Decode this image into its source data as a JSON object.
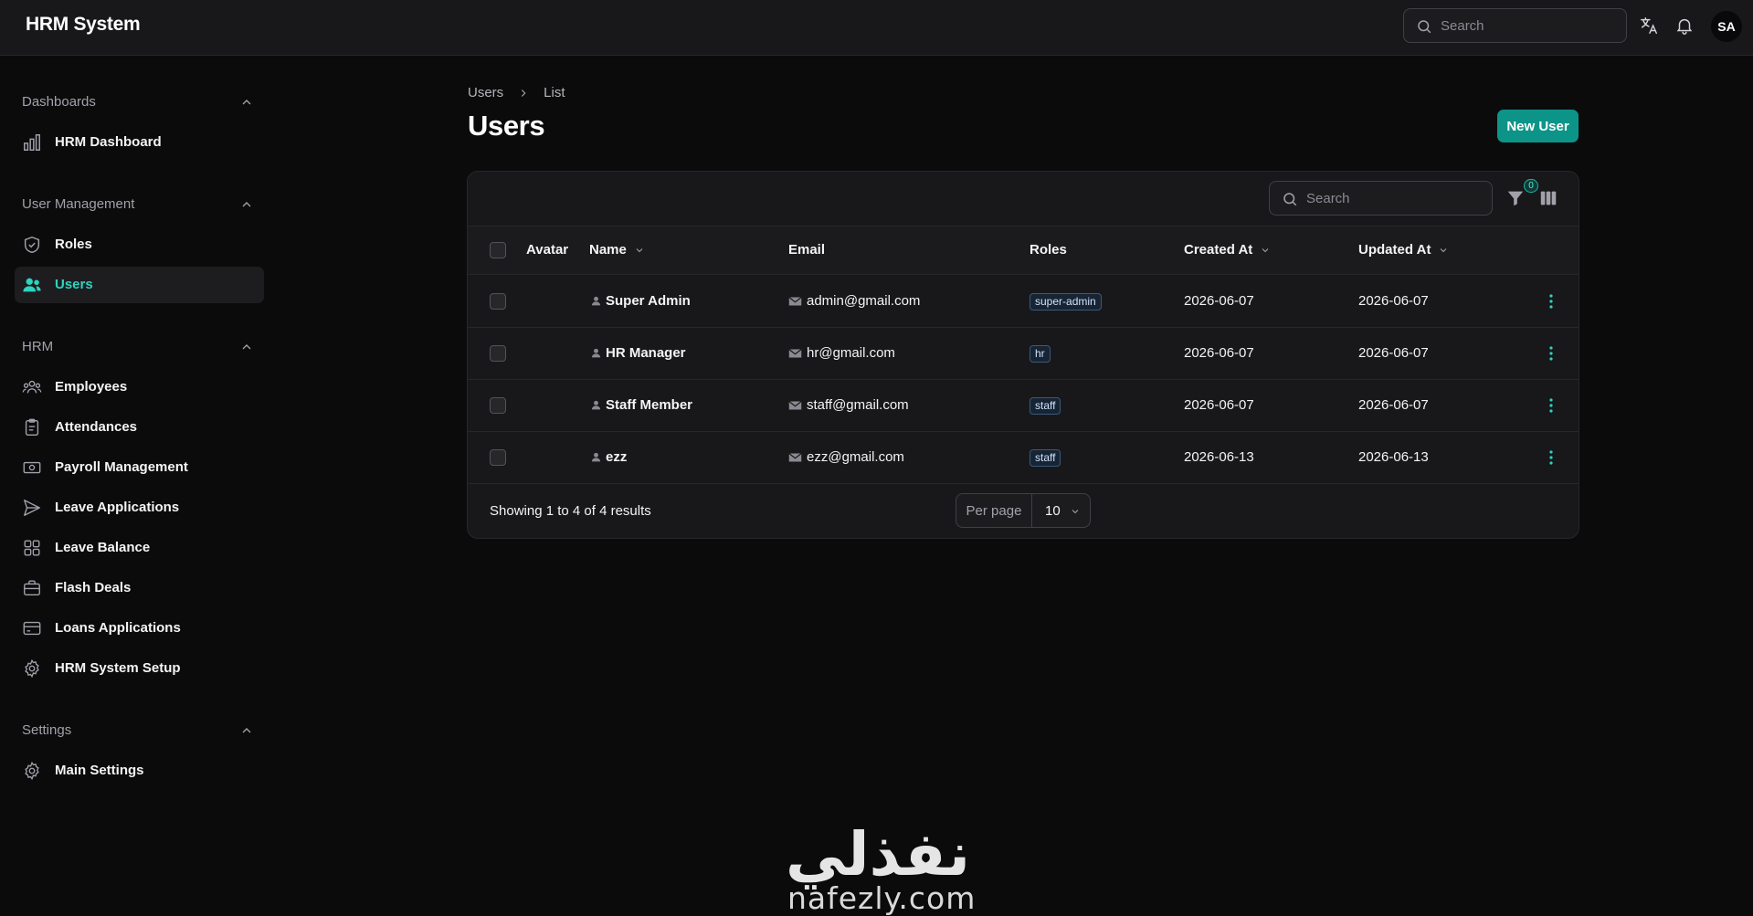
{
  "app": {
    "brand": "HRM System",
    "user_initials": "SA"
  },
  "header": {
    "search_placeholder": "Search"
  },
  "sidebar": {
    "groups": [
      {
        "label": "Dashboards",
        "items": [
          {
            "label": "HRM Dashboard",
            "icon": "bar-chart-icon"
          }
        ]
      },
      {
        "label": "User Management",
        "items": [
          {
            "label": "Roles",
            "icon": "shield-check-icon"
          },
          {
            "label": "Users",
            "icon": "users-icon",
            "active": true
          }
        ]
      },
      {
        "label": "HRM",
        "items": [
          {
            "label": "Employees",
            "icon": "user-group-icon"
          },
          {
            "label": "Attendances",
            "icon": "clipboard-icon"
          },
          {
            "label": "Payroll Management",
            "icon": "banknote-icon"
          },
          {
            "label": "Leave Applications",
            "icon": "send-icon"
          },
          {
            "label": "Leave Balance",
            "icon": "grid-icon"
          },
          {
            "label": "Flash Deals",
            "icon": "briefcase-icon"
          },
          {
            "label": "Loans Applications",
            "icon": "credit-card-icon"
          },
          {
            "label": "HRM System Setup",
            "icon": "gear-icon"
          }
        ]
      },
      {
        "label": "Settings",
        "items": [
          {
            "label": "Main Settings",
            "icon": "gear-icon"
          }
        ]
      }
    ]
  },
  "breadcrumb": [
    "Users",
    "List"
  ],
  "page": {
    "title": "Users",
    "new_button": "New User"
  },
  "table": {
    "search_placeholder": "Search",
    "filter_count": "0",
    "columns": [
      "Avatar",
      "Name",
      "Email",
      "Roles",
      "Created At",
      "Updated At"
    ],
    "rows": [
      {
        "name": "Super Admin",
        "email": "admin@gmail.com",
        "role": "super-admin",
        "created": "2026-06-07",
        "updated": "2026-06-07"
      },
      {
        "name": "HR Manager",
        "email": "hr@gmail.com",
        "role": "hr",
        "created": "2026-06-07",
        "updated": "2026-06-07"
      },
      {
        "name": "Staff Member",
        "email": "staff@gmail.com",
        "role": "staff",
        "created": "2026-06-07",
        "updated": "2026-06-07"
      },
      {
        "name": "ezz",
        "email": "ezz@gmail.com",
        "role": "staff",
        "created": "2026-06-13",
        "updated": "2026-06-13"
      }
    ],
    "footer": {
      "results": "Showing 1 to 4 of 4 results",
      "per_page_label": "Per page",
      "per_page_value": "10"
    }
  },
  "watermark": {
    "arabic": "نفذلي",
    "url": "nafezly.com"
  },
  "colors": {
    "accent": "#0d9488",
    "active_text": "#2dd4bf",
    "background": "#0b0b0c",
    "surface": "#18181b"
  }
}
